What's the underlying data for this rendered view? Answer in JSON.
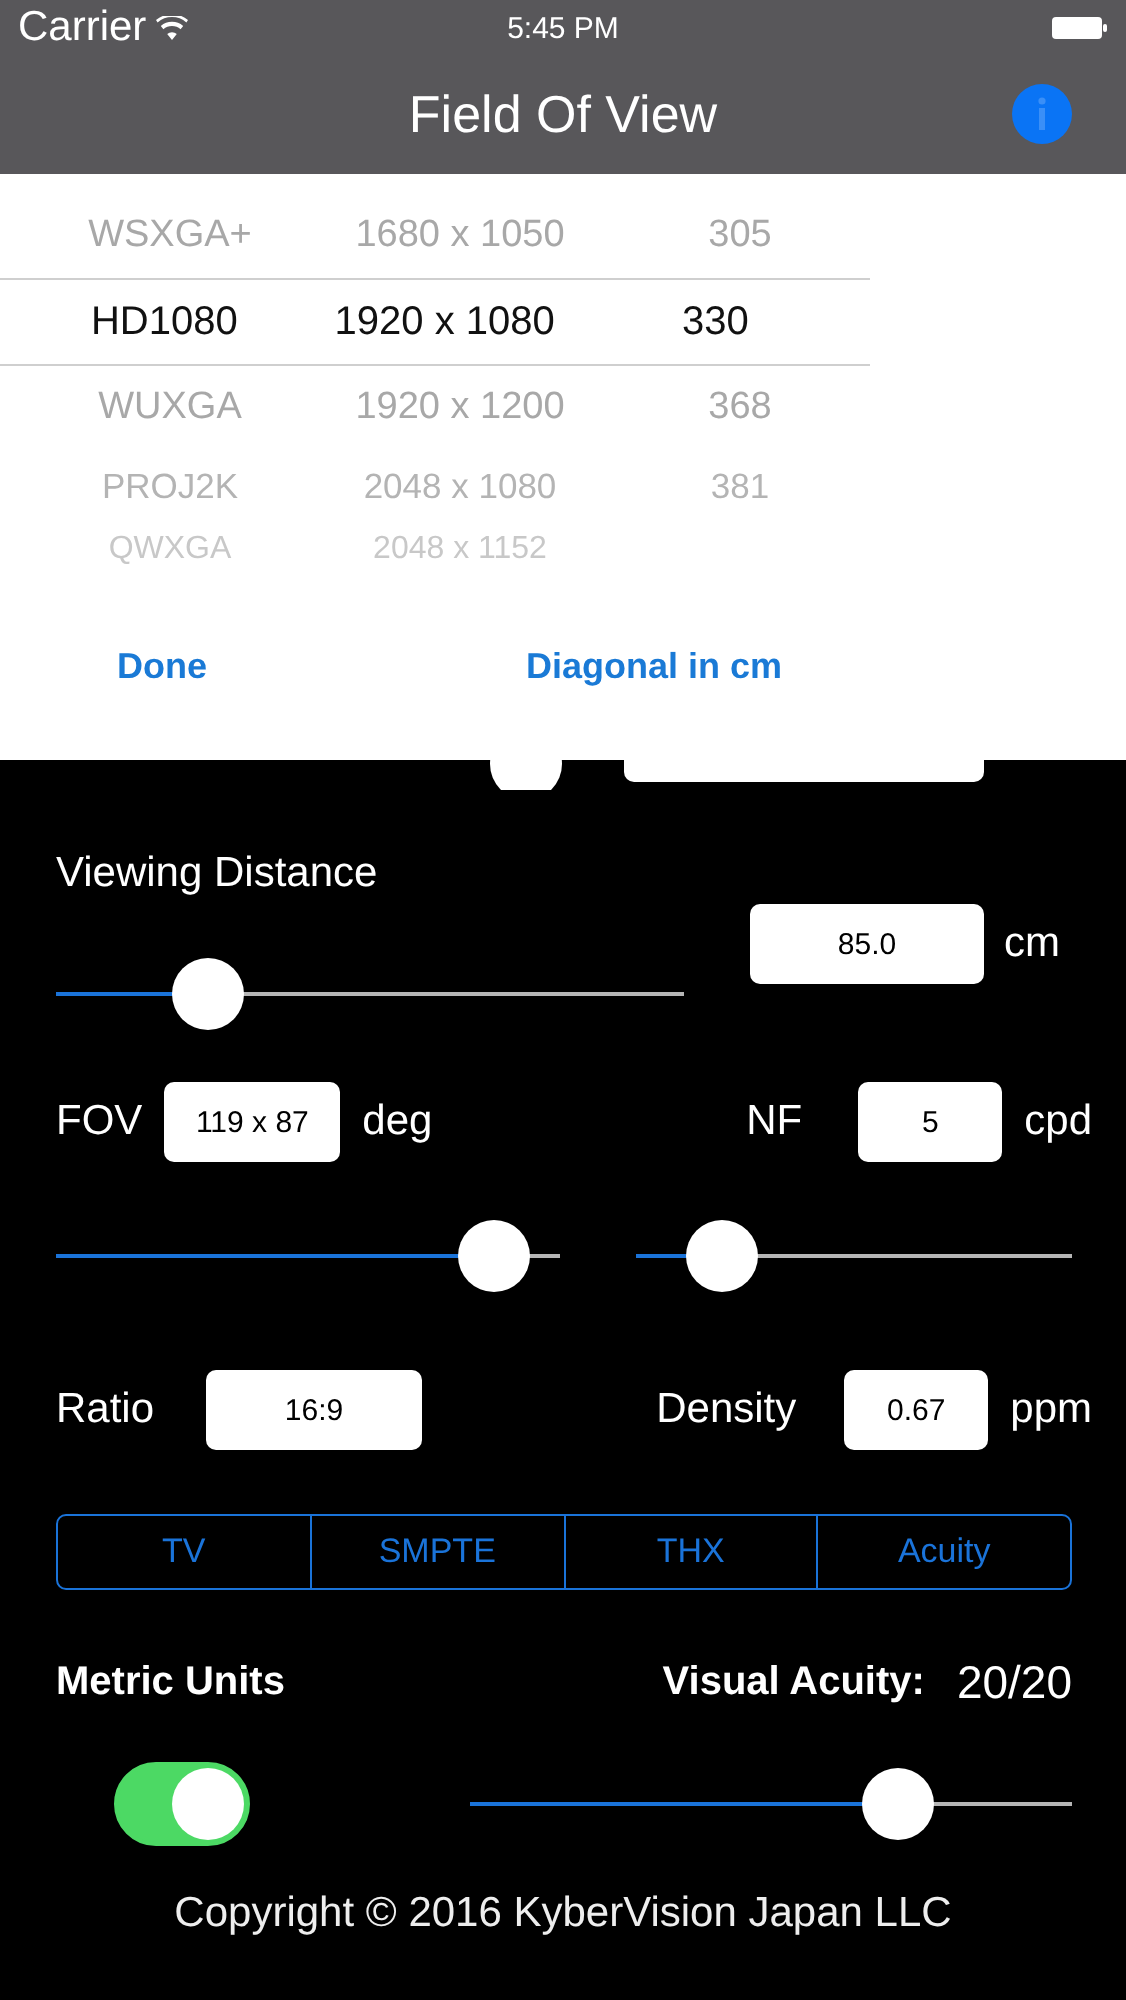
{
  "status_bar": {
    "carrier": "Carrier",
    "time": "5:45 PM"
  },
  "nav_bar": {
    "title": "Field Of View"
  },
  "picker": {
    "rows": [
      {
        "name": "WSXGA+",
        "resolution": "1680 x 1050",
        "value": "305",
        "selected": false
      },
      {
        "name": "HD1080",
        "resolution": "1920 x 1080",
        "value": "330",
        "selected": true
      },
      {
        "name": "WUXGA",
        "resolution": "1920 x 1200",
        "value": "368",
        "selected": false
      },
      {
        "name": "PROJ2K",
        "resolution": "2048 x 1080",
        "value": "381",
        "selected": false
      },
      {
        "name": "QWXGA",
        "resolution": "2048 x 1152",
        "selected": false
      }
    ],
    "buttons": [
      "Done",
      "Diagonal in cm"
    ]
  },
  "viewing_distance": {
    "label": "Viewing Distance",
    "level": 0.21,
    "value": "85.0",
    "unit": "cm"
  },
  "fov": {
    "label": "FOV",
    "value": "119 x 87",
    "unit": "deg",
    "level": 0.93
  },
  "nf": {
    "label": "NF",
    "value": "5",
    "unit": "cpd",
    "level": 0.14
  },
  "ratio": {
    "label": "Ratio",
    "value": "16:9"
  },
  "density": {
    "label": "Density",
    "value": "0.67",
    "unit": "ppm"
  },
  "segments": [
    {
      "label": "TV",
      "selected": false
    },
    {
      "label": "SMPTE",
      "selected": false
    },
    {
      "label": "THX",
      "selected": false
    },
    {
      "label": "Acuity",
      "selected": false
    }
  ],
  "metric_units": {
    "label": "Metric Units",
    "on": true
  },
  "visual_acuity": {
    "label": "Visual Acuity:",
    "value": "20/20",
    "level": 0.74
  },
  "footer": "Copyright © 2016 KyberVision Japan LLC"
}
